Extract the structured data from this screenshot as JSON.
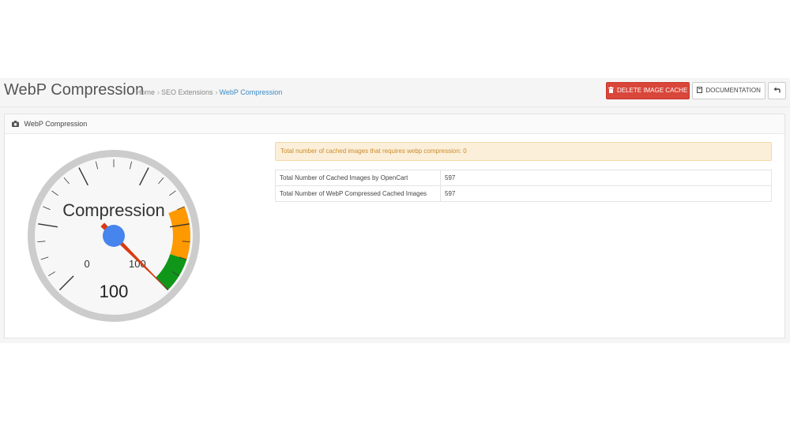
{
  "header": {
    "title": "WebP Compression",
    "breadcrumb": [
      "Home",
      "SEO Extensions",
      "WebP Compression"
    ],
    "buttons": {
      "delete_cache": "DELETE IMAGE CACHE",
      "documentation": "DOCUMENTATION"
    }
  },
  "panel": {
    "title": "WebP Compression",
    "alert": "Total number of cached images that requires webp compression: 0",
    "stats": [
      {
        "label": "Total Number of Cached Images by OpenCart",
        "value": "597"
      },
      {
        "label": "Total Number of WebP Compressed Cached Images",
        "value": "597"
      }
    ]
  },
  "gauge": {
    "label": "Compression",
    "value": "100",
    "min_label": "0",
    "max_label": "100",
    "fraction": 1.0,
    "colors": {
      "yellow": "#ff9900",
      "green": "#109618",
      "needle": "#dc3912",
      "hub": "#4684ee"
    }
  },
  "colors": {
    "danger": "#d9463a",
    "link": "#3a8ac4",
    "alert_bg": "#fcefd9",
    "alert_text": "#c98b2c"
  }
}
